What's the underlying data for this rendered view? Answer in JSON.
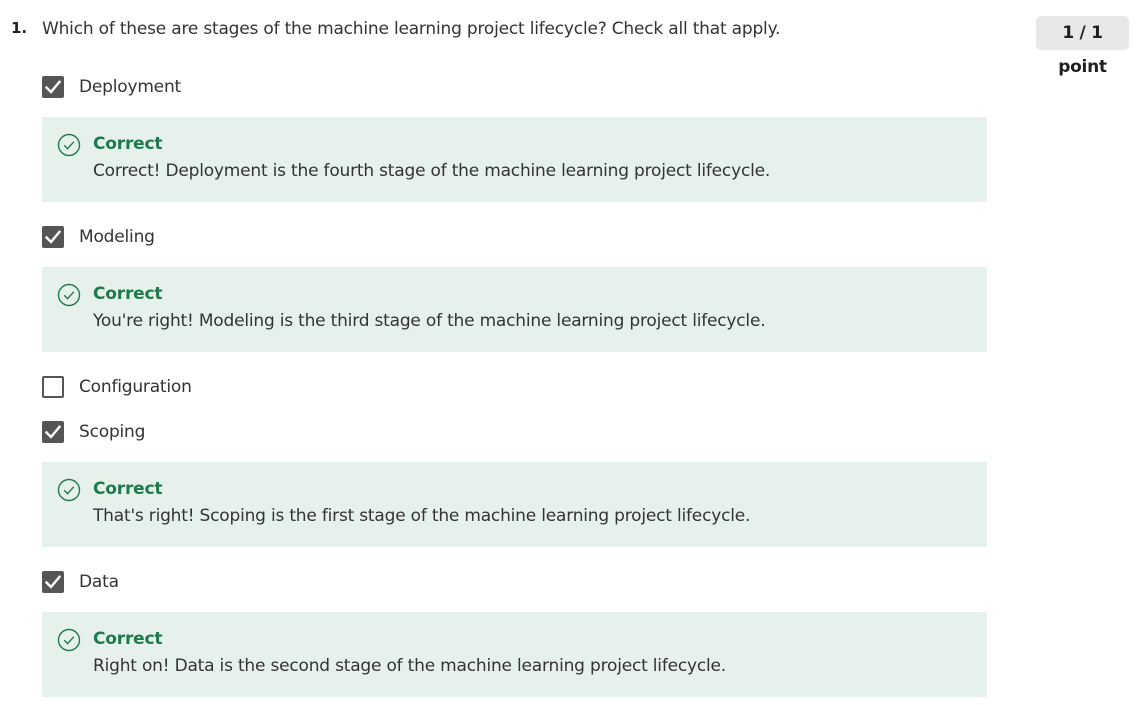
{
  "question": {
    "number": "1.",
    "text": "Which of these are stages of the machine learning project lifecycle? Check all that apply.",
    "score": "1 / 1 point"
  },
  "options": [
    {
      "label": "Deployment",
      "checked": true
    },
    {
      "label": "Modeling",
      "checked": true
    },
    {
      "label": "Configuration",
      "checked": false
    },
    {
      "label": "Scoping",
      "checked": true
    },
    {
      "label": "Data",
      "checked": true
    }
  ],
  "feedback": [
    {
      "title": "Correct",
      "text": "Correct! Deployment is the fourth stage of the machine learning project lifecycle."
    },
    {
      "title": "Correct",
      "text": "You're right! Modeling is the third stage of the machine learning project lifecycle."
    },
    {
      "title": "Correct",
      "text": "That's right! Scoping is the first stage of the machine learning project lifecycle."
    },
    {
      "title": "Correct",
      "text": "Right on! Data is the second stage of the machine learning project lifecycle."
    }
  ],
  "colors": {
    "checkbox": "#555555",
    "feedback_bg": "#e7f1ec",
    "correct_green": "#1e7a4c",
    "score_bg": "#e8e8e8"
  },
  "icons": {
    "checked": "checkmark-icon",
    "feedback": "check-circle-icon"
  }
}
